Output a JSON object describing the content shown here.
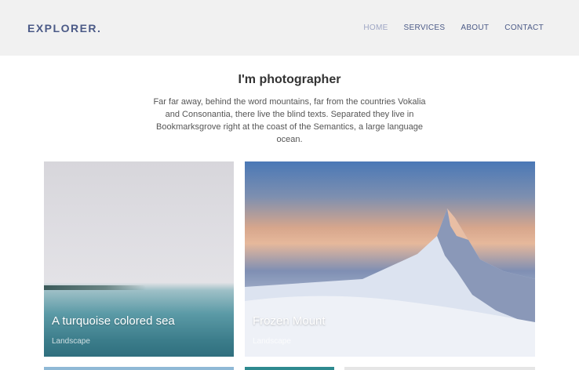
{
  "header": {
    "logo": "EXPLORER.",
    "nav": [
      {
        "label": "HOME",
        "active": true
      },
      {
        "label": "SERVICES",
        "active": false
      },
      {
        "label": "ABOUT",
        "active": false
      },
      {
        "label": "CONTACT",
        "active": false
      }
    ],
    "logo_color": "#4b5a87",
    "active_nav_color": "#9ea6c4",
    "background": "#f1f1f1"
  },
  "intro": {
    "title": "I'm photographer",
    "text": "Far far away, behind the word mountains, far from the countries Vokalia and Consonantia, there live the blind texts. Separated they live in Bookmarksgrove right at the coast of the Semantics, a large language ocean."
  },
  "gallery": [
    {
      "title": "A turquoise colored sea",
      "category": "Landscape"
    },
    {
      "title": "Frozen Mount",
      "category": "Landscape"
    }
  ]
}
